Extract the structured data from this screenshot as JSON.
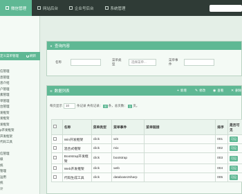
{
  "topnav": {
    "items": [
      {
        "label": "微信管理",
        "active": true
      },
      {
        "label": "网站后台",
        "active": false
      },
      {
        "label": "企业号后台",
        "active": false
      },
      {
        "label": "系统管理",
        "active": false
      }
    ]
  },
  "sidebar": {
    "header_label": "定义菜单管理",
    "refresh_label": "刷新",
    "items": [
      "信管理",
      "息管理",
      "息介绍",
      "户管理",
      "素管理",
      "单管理",
      "台管理",
      "发框架",
      "发框架",
      "发框架",
      "p开发框架",
      "开发框架",
      "代码工具",
      "信管理",
      "级",
      "统",
      "管理",
      "运用",
      "统",
      "计"
    ]
  },
  "query": {
    "title": "查询内容",
    "name_label": "名称",
    "menu_type_label": "菜单类型",
    "menu_type_placeholder": "选择菜单...",
    "menu_event_label": "菜单事件"
  },
  "data": {
    "title": "数据列表",
    "toolbar": {
      "add": "新增",
      "edit": "修改",
      "view": "查看",
      "delete": "删除"
    },
    "pager": {
      "prefix": "每页显示",
      "page_size": "10",
      "records_suffix": "条记录 共有记录：",
      "total": "8",
      "pages_prefix": "条，总页数：",
      "pages": "1",
      "pages_suffix": "页。"
    },
    "columns": [
      "名称",
      "菜单类型",
      "菜单事件",
      "菜单链接",
      "排序",
      "是否可见"
    ],
    "rows": [
      {
        "name": "Win开发框架",
        "type": "click",
        "event": "win",
        "link": "",
        "sort": "001",
        "visible": "可见"
      },
      {
        "name": "混合式框架",
        "type": "click",
        "event": "mix",
        "link": "",
        "sort": "002",
        "visible": "可见"
      },
      {
        "name": "Bootstrap开发框架",
        "type": "click",
        "event": "bootstrap",
        "link": "",
        "sort": "003",
        "visible": "可见"
      },
      {
        "name": "Web开发框架",
        "type": "click",
        "event": "web",
        "link": "",
        "sort": "004",
        "visible": "可见"
      },
      {
        "name": "代码生成工具",
        "type": "click",
        "event": "database2sharp",
        "link": "",
        "sort": "005",
        "visible": "可见"
      }
    ]
  },
  "colors": {
    "accent": "#5fb894",
    "topbar": "#2f3b36",
    "background": "#e4efe7"
  }
}
